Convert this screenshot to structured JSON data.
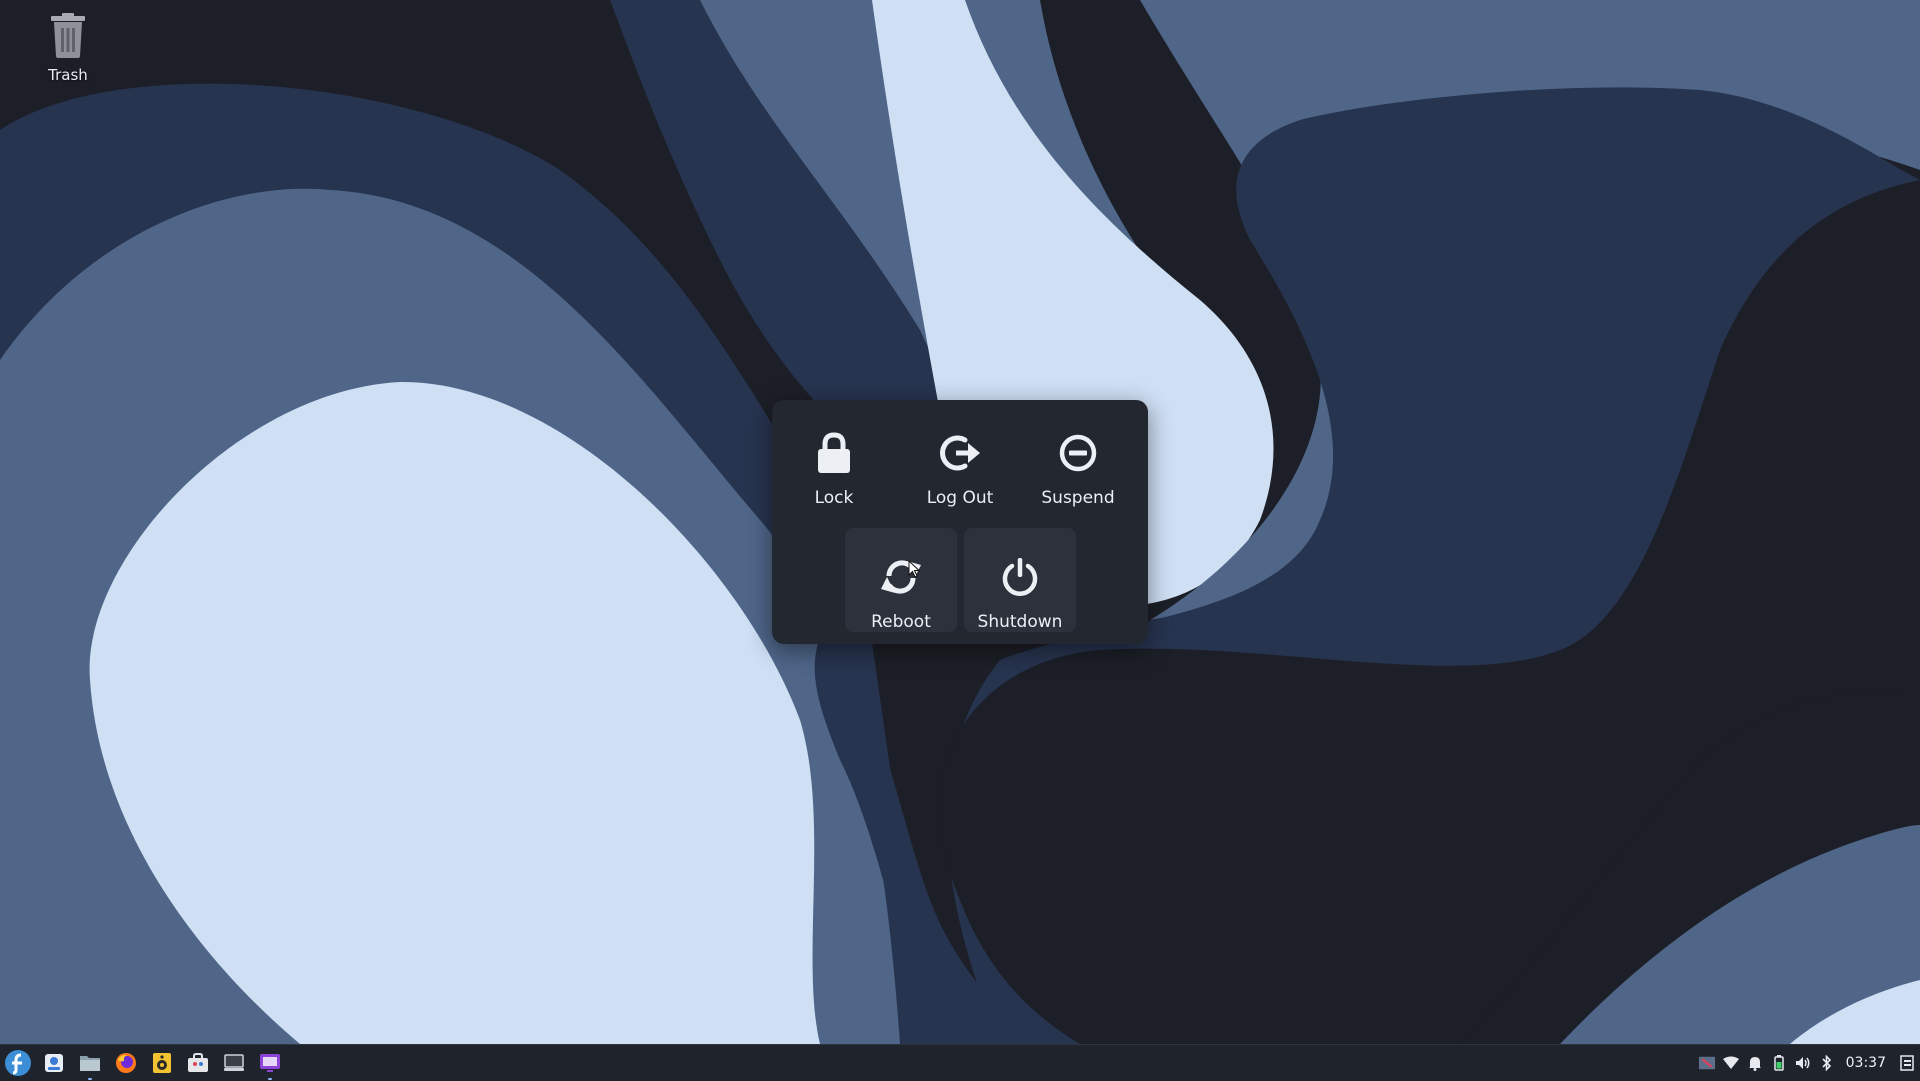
{
  "desktop": {
    "icons": [
      {
        "label": "Trash",
        "icon": "trash-icon"
      }
    ]
  },
  "power_dialog": {
    "buttons": [
      {
        "id": "lock",
        "label": "Lock",
        "icon": "lock-icon"
      },
      {
        "id": "logout",
        "label": "Log Out",
        "icon": "logout-icon"
      },
      {
        "id": "suspend",
        "label": "Suspend",
        "icon": "suspend-icon"
      },
      {
        "id": "reboot",
        "label": "Reboot",
        "icon": "reboot-icon",
        "hovered": true
      },
      {
        "id": "shutdown",
        "label": "Shutdown",
        "icon": "power-icon"
      }
    ]
  },
  "taskbar": {
    "launcher_icon": "fedora-logo-icon",
    "apps": [
      {
        "icon": "system-settings-icon"
      },
      {
        "icon": "file-manager-icon",
        "active": true
      },
      {
        "icon": "firefox-icon"
      },
      {
        "icon": "audio-player-icon"
      },
      {
        "icon": "software-store-icon"
      },
      {
        "icon": "terminal-icon"
      },
      {
        "icon": "screenshot-tool-icon",
        "active": true
      }
    ],
    "tray": [
      "flag-icon",
      "wifi-icon",
      "notification-bell-icon",
      "battery-icon",
      "volume-icon",
      "bluetooth-icon"
    ],
    "clock": "03:37",
    "show_desktop_icon": "show-desktop-icon"
  },
  "colors": {
    "wall_dark": "#1c1f27",
    "wall_navy": "#27344f",
    "wall_mid": "#4f6689",
    "wall_light": "#cfdff4",
    "dialog_bg": "#232730",
    "taskbar_bg": "#1f232b"
  }
}
